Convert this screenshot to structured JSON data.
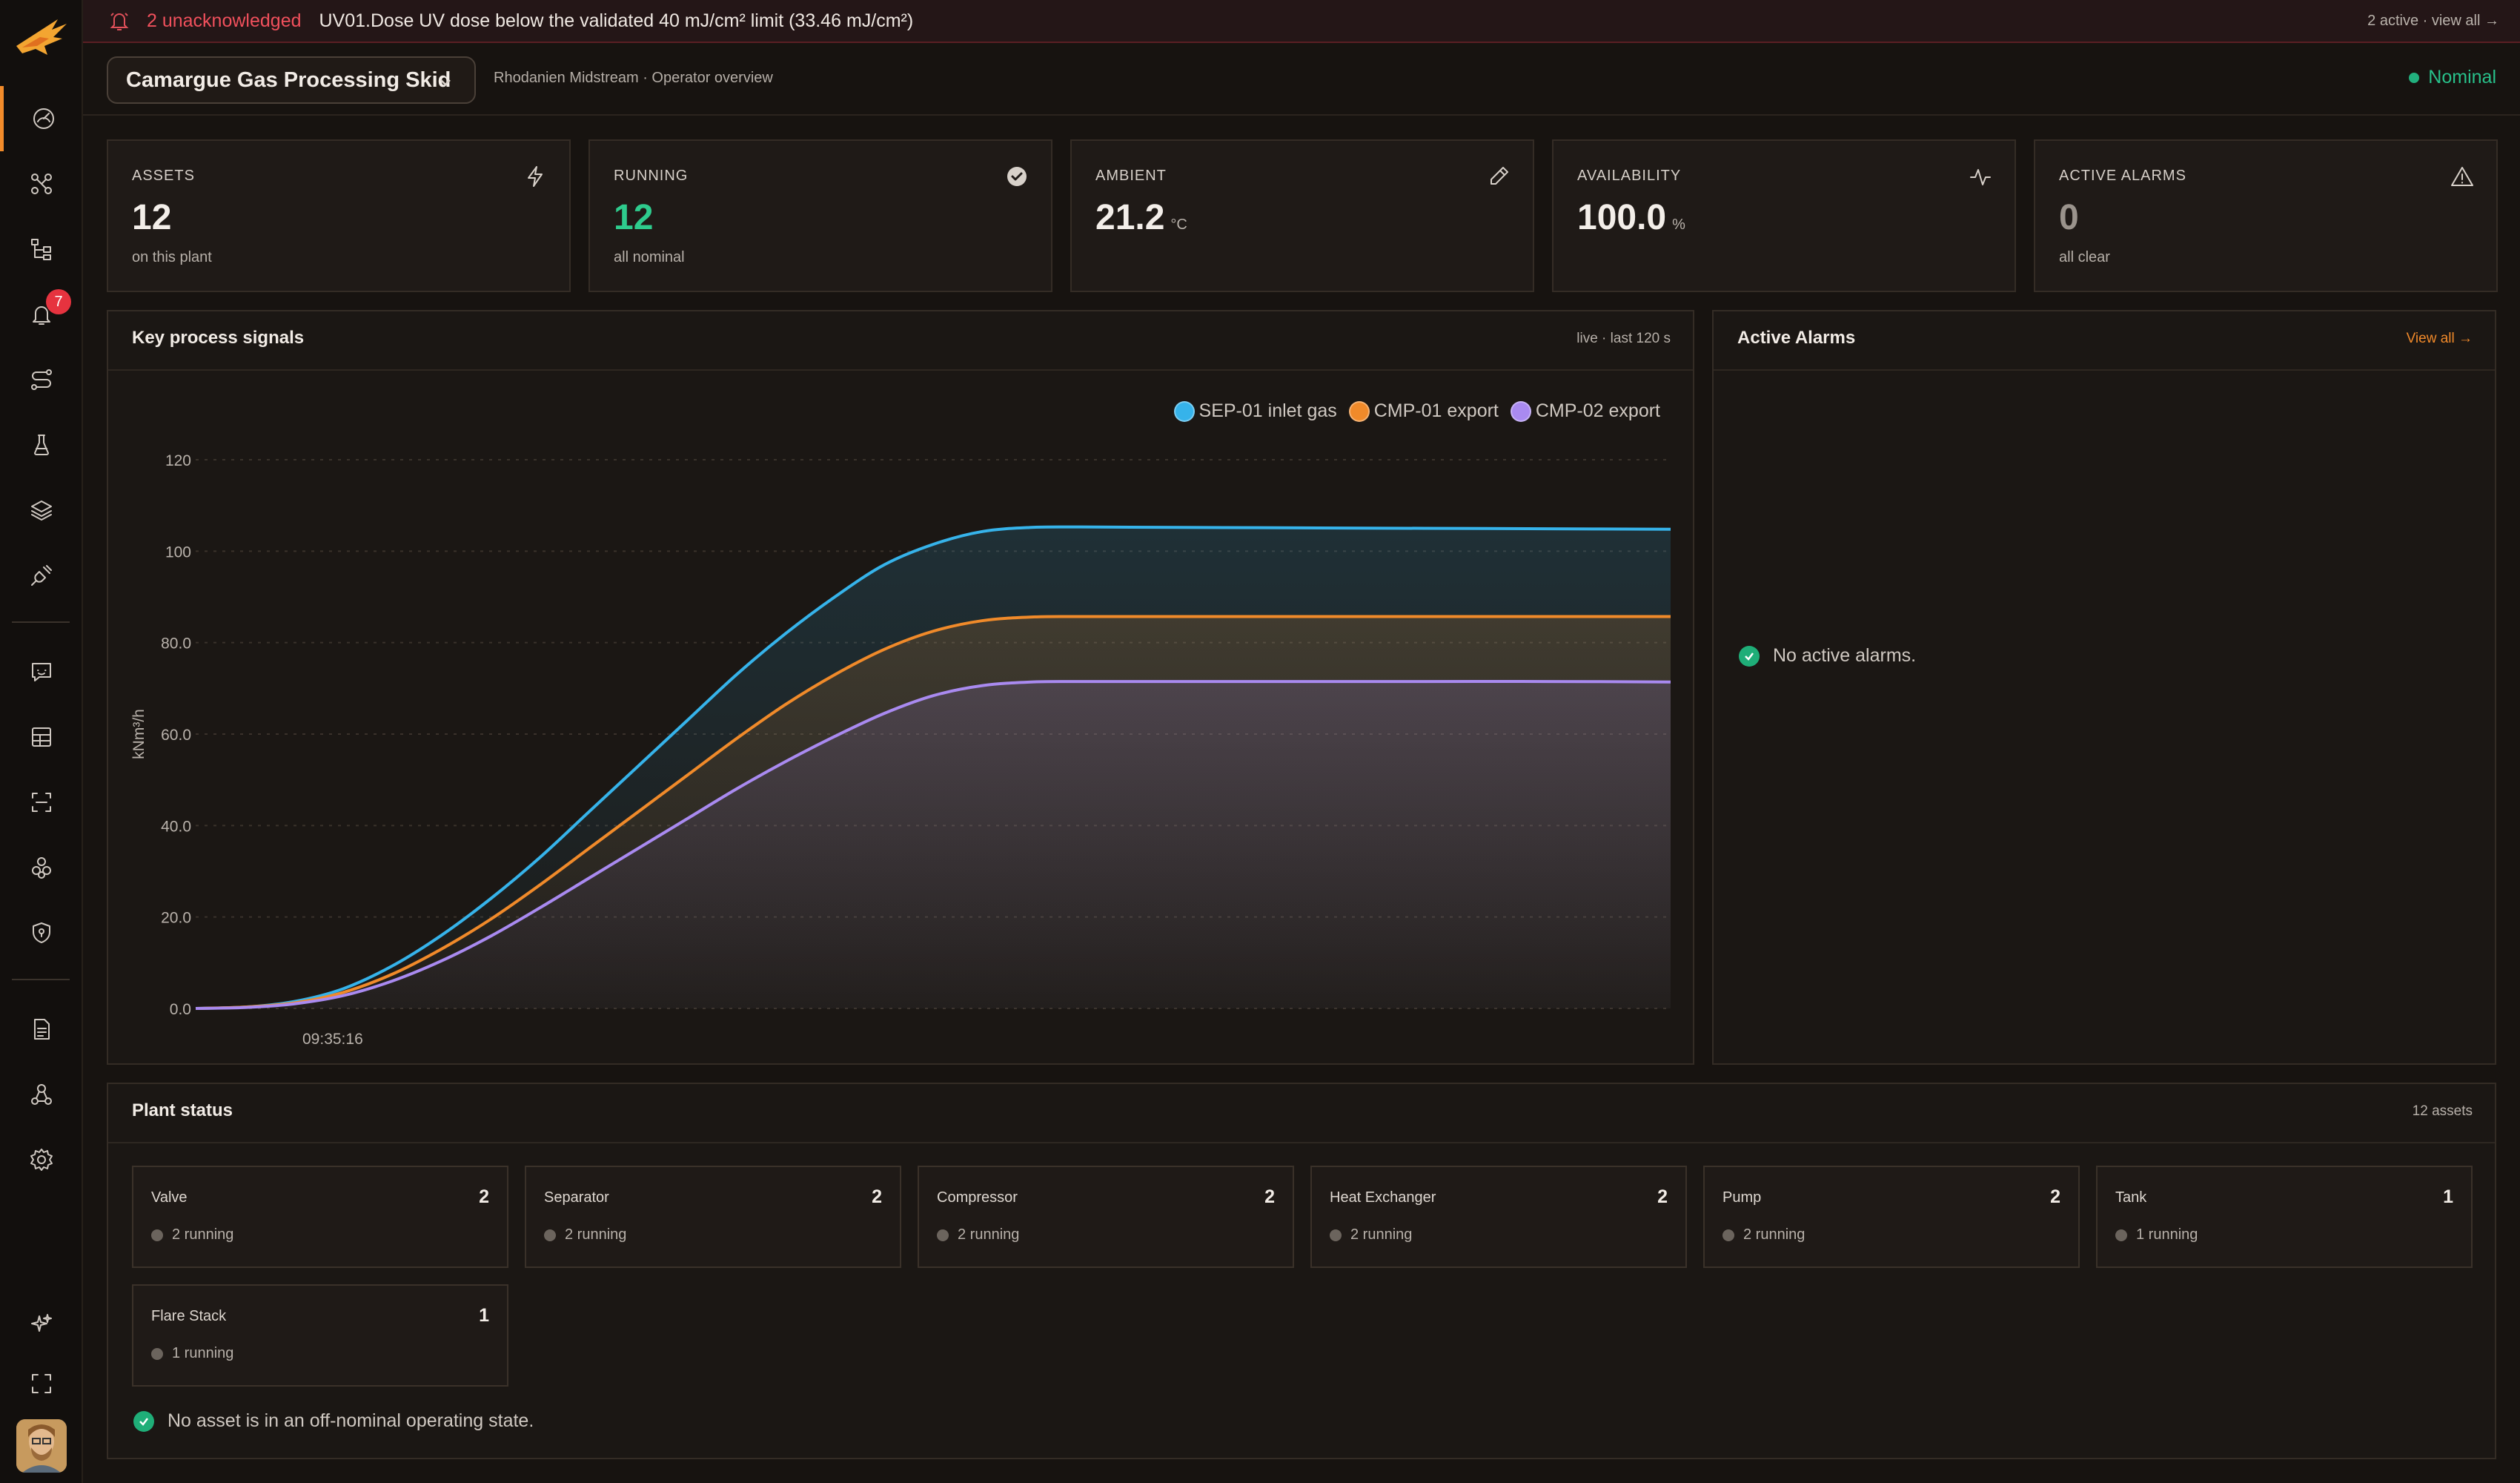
{
  "banner": {
    "count": "2 unacknowledged",
    "message": "UV01.Dose UV dose below the validated 40 mJ/cm² limit (33.46 mJ/cm²)",
    "right": "2 active · view all →",
    "color": "#f0505c"
  },
  "sidebar": {
    "alarm_badge": "7",
    "items": [
      "dashboard-icon",
      "topology-icon",
      "hierarchy-icon",
      "alarms-bell-icon",
      "routes-icon",
      "lab-flask-icon",
      "layers-icon",
      "plug-icon",
      "chat-icon",
      "grid-icon",
      "scan-icon",
      "components-icon",
      "shield-icon",
      "document-icon",
      "network-icon",
      "settings-icon",
      "sparkle-icon",
      "fullscreen-icon"
    ]
  },
  "header": {
    "plant_name": "Camargue Gas Processing Skid",
    "subtitle": "Rhodanien Midstream · Operator overview",
    "status": "Nominal",
    "status_color": "#28c08a"
  },
  "kpis": [
    {
      "label": "ASSETS",
      "value": "12",
      "unit": "",
      "foot": "on this plant",
      "icon": "bolt-icon"
    },
    {
      "label": "RUNNING",
      "value": "12",
      "unit": "",
      "foot": "all nominal",
      "icon": "check-circle-icon"
    },
    {
      "label": "AMBIENT",
      "value": "21.2",
      "unit": "°C",
      "foot": "",
      "icon": "thermometer-icon"
    },
    {
      "label": "AVAILABILITY",
      "value": "100.0",
      "unit": "%",
      "foot": "",
      "icon": "pulse-icon"
    },
    {
      "label": "ACTIVE ALARMS",
      "value": "0",
      "unit": "",
      "foot": "all clear",
      "icon": "warning-triangle-icon"
    }
  ],
  "signals_panel": {
    "title": "Key process signals",
    "right": "live · last 120 s"
  },
  "chart_data": {
    "type": "area",
    "ylabel": "kNm³/h",
    "xlabel": "",
    "ylim": [
      0,
      120
    ],
    "yticks": [
      "0.0",
      "20.0",
      "40.0",
      "60.0",
      "80.0",
      "100",
      "120"
    ],
    "xticks": [
      "09:35:16"
    ],
    "x": [
      0,
      4,
      8,
      12,
      16,
      20,
      24,
      28,
      32,
      36,
      40,
      44,
      48,
      52,
      56,
      60,
      64,
      68,
      72,
      80,
      90,
      100,
      110,
      120
    ],
    "series": [
      {
        "name": "SEP-01 inlet gas",
        "color": "#36b3ea",
        "values": [
          0,
          0.3,
          1.5,
          4.3,
          9.3,
          16,
          24,
          33,
          43,
          53,
          63,
          73,
          82,
          90,
          97,
          101.5,
          104.3,
          105.2,
          105.3,
          105.2,
          105.1,
          105.0,
          104.9,
          104.8
        ]
      },
      {
        "name": "CMP-01 export",
        "color": "#f08a2a",
        "values": [
          0,
          0.3,
          1.2,
          3.5,
          7.5,
          13,
          19.5,
          27,
          35,
          43,
          51,
          59,
          66.5,
          73,
          78.5,
          82.5,
          84.8,
          85.6,
          85.7,
          85.7,
          85.7,
          85.7,
          85.7,
          85.7
        ]
      },
      {
        "name": "CMP-02 export",
        "color": "#a98af0",
        "values": [
          0,
          0.2,
          1.0,
          2.8,
          6.0,
          10.4,
          15.8,
          22,
          28.5,
          35,
          41.5,
          48,
          54,
          59.5,
          64.5,
          68.4,
          70.6,
          71.4,
          71.5,
          71.5,
          71.5,
          71.5,
          71.5,
          71.4
        ]
      }
    ]
  },
  "alarms_panel": {
    "title": "Active Alarms",
    "view_all": "View all →",
    "empty": "No active alarms."
  },
  "plant_status": {
    "title": "Plant status",
    "right": "12 assets",
    "assets": [
      {
        "name": "Valve",
        "count": "2",
        "running": "2 running"
      },
      {
        "name": "Separator",
        "count": "2",
        "running": "2 running"
      },
      {
        "name": "Compressor",
        "count": "2",
        "running": "2 running"
      },
      {
        "name": "Heat Exchanger",
        "count": "2",
        "running": "2 running"
      },
      {
        "name": "Pump",
        "count": "2",
        "running": "2 running"
      },
      {
        "name": "Tank",
        "count": "1",
        "running": "1 running"
      },
      {
        "name": "Flare Stack",
        "count": "1",
        "running": "1 running"
      }
    ],
    "footer": "No asset is in an off-nominal operating state."
  }
}
